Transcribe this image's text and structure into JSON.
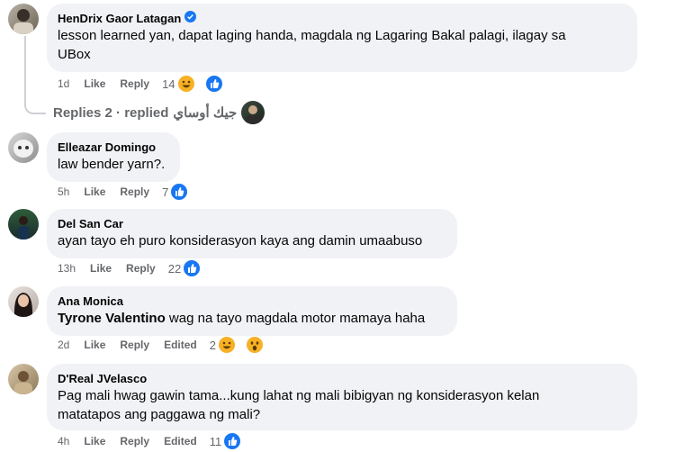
{
  "comments": [
    {
      "name": "HenDrix Gaor Latagan",
      "verified": true,
      "lines": [
        "lesson learned yan, dapat laging handa, magdala ng Lagaring Bakal palagi, ilagay sa",
        "UBox"
      ],
      "time": "1d",
      "like": "Like",
      "reply": "Reply",
      "count": "14",
      "reactions": [
        "haha",
        "like"
      ]
    },
    {
      "name": "Elleazar Domingo",
      "lines": [
        "law bender yarn?."
      ],
      "time": "5h",
      "like": "Like",
      "reply": "Reply",
      "count": "7",
      "reactions": [
        "like"
      ]
    },
    {
      "name": "Del San Car",
      "lines": [
        "ayan tayo eh puro konsiderasyon kaya ang damin umaabuso"
      ],
      "time": "13h",
      "like": "Like",
      "reply": "Reply",
      "count": "22",
      "reactions": [
        "like"
      ]
    },
    {
      "name": "Ana Monica",
      "mention": "Tyrone Valentino",
      "lines": [
        " wag na tayo magdala motor mamaya haha"
      ],
      "time": "2d",
      "like": "Like",
      "reply": "Reply",
      "edited": "Edited",
      "count": "2",
      "reactions": [
        "haha",
        "wow"
      ]
    },
    {
      "name": "D'Real JVelasco",
      "lines": [
        "Pag mali hwag gawin tama...kung lahat ng mali bibigyan ng konsiderasyon kelan",
        "matatapos ang paggawa ng mali?"
      ],
      "time": "4h",
      "like": "Like",
      "reply": "Reply",
      "edited": "Edited",
      "count": "11",
      "reactions": [
        "like"
      ]
    }
  ],
  "replies_row": {
    "label": "Replies 2 · replied",
    "replier": "جيك أوساي"
  },
  "colors": {
    "like": "#1877f2",
    "haha": "#f7b125",
    "bubble": "#f0f2f5",
    "meta": "#65676b"
  }
}
